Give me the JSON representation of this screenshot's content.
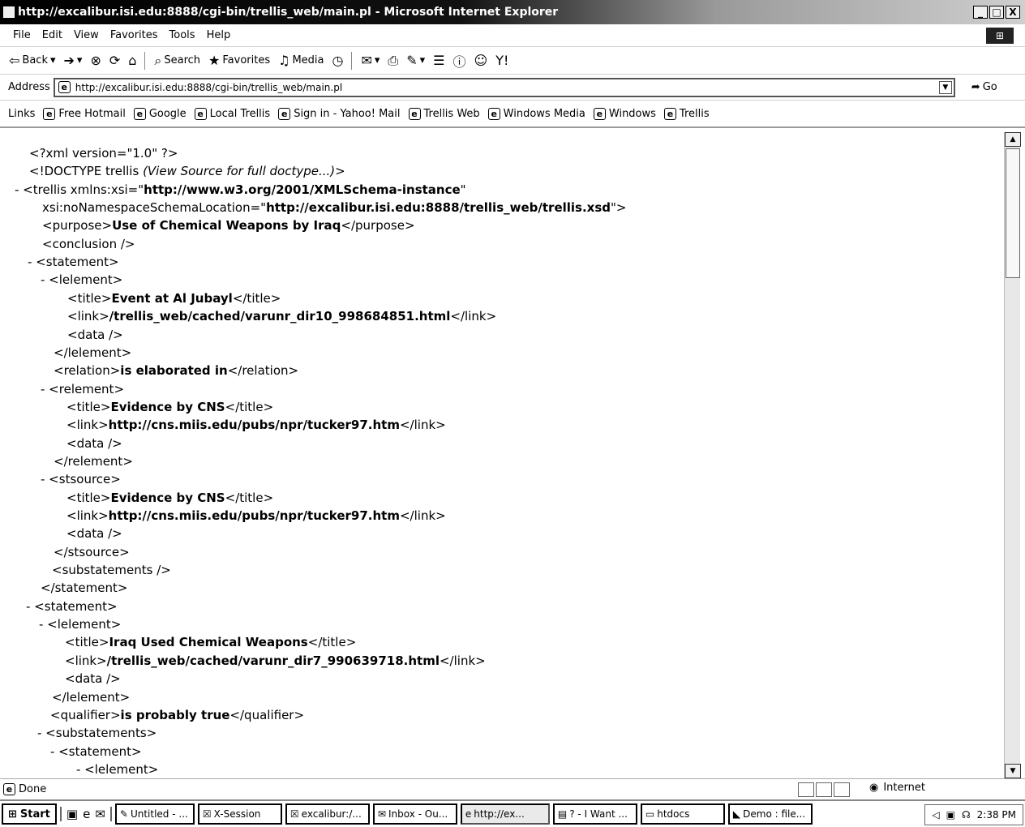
{
  "window": {
    "title": "http://excalibur.isi.edu:8888/cgi-bin/trellis_web/main.pl - Microsoft Internet Explorer",
    "minimize": "_",
    "maximize": "□",
    "close": "X"
  },
  "menu": [
    "File",
    "Edit",
    "View",
    "Favorites",
    "Tools",
    "Help"
  ],
  "toolbar": {
    "back": "Back",
    "search": "Search",
    "favorites": "Favorites",
    "media": "Media"
  },
  "address": {
    "label": "Address",
    "url": "http://excalibur.isi.edu:8888/cgi-bin/trellis_web/main.pl",
    "go": "Go"
  },
  "links": {
    "label": "Links",
    "items": [
      "Free Hotmail",
      "Google",
      "Local Trellis",
      "Sign in - Yahoo! Mail",
      "Trellis Web",
      "Windows Media",
      "Windows",
      "Trellis"
    ]
  },
  "xml": [
    {
      "indent": 36,
      "parts": [
        [
          "n",
          "<?xml version=\"1.0\" ?>"
        ]
      ]
    },
    {
      "indent": 36,
      "parts": [
        [
          "n",
          "<!DOCTYPE trellis "
        ],
        [
          "i",
          "(View Source for full doctype...)"
        ],
        [
          "n",
          ">"
        ]
      ]
    },
    {
      "indent": 18,
      "parts": [
        [
          "n",
          "- <trellis xmlns:xsi=\""
        ],
        [
          "b",
          "http://www.w3.org/2001/XMLSchema-instance"
        ],
        [
          "n",
          "\""
        ]
      ]
    },
    {
      "indent": 52,
      "parts": [
        [
          "n",
          "xsi:noNamespaceSchemaLocation=\""
        ],
        [
          "b",
          "http://excalibur.isi.edu:8888/trellis_web/trellis.xsd"
        ],
        [
          "n",
          "\">"
        ]
      ]
    },
    {
      "indent": 52,
      "parts": [
        [
          "n",
          "<purpose>"
        ],
        [
          "b",
          "Use of Chemical Weapons by Iraq"
        ],
        [
          "n",
          "</purpose>"
        ]
      ]
    },
    {
      "indent": 52,
      "parts": [
        [
          "n",
          "<conclusion />"
        ]
      ]
    },
    {
      "indent": 34,
      "parts": [
        [
          "n",
          "- <statement>"
        ]
      ]
    },
    {
      "indent": 50,
      "parts": [
        [
          "n",
          "- <lelement>"
        ]
      ]
    },
    {
      "indent": 83,
      "parts": [
        [
          "n",
          "<title>"
        ],
        [
          "b",
          "Event at Al Jubayl"
        ],
        [
          "n",
          "</title>"
        ]
      ]
    },
    {
      "indent": 83,
      "parts": [
        [
          "n",
          "<link>"
        ],
        [
          "b",
          "/trellis_web/cached/varunr_dir10_998684851.html"
        ],
        [
          "n",
          "</link>"
        ]
      ]
    },
    {
      "indent": 83,
      "parts": [
        [
          "n",
          "<data />"
        ]
      ]
    },
    {
      "indent": 66,
      "parts": [
        [
          "n",
          "</lelement>"
        ]
      ]
    },
    {
      "indent": 66,
      "parts": [
        [
          "n",
          "<relation>"
        ],
        [
          "b",
          "is elaborated in"
        ],
        [
          "n",
          "</relation>"
        ]
      ]
    },
    {
      "indent": 50,
      "parts": [
        [
          "n",
          "- <relement>"
        ]
      ]
    },
    {
      "indent": 82,
      "parts": [
        [
          "n",
          "<title>"
        ],
        [
          "b",
          "Evidence by CNS"
        ],
        [
          "n",
          "</title>"
        ]
      ]
    },
    {
      "indent": 82,
      "parts": [
        [
          "n",
          "<link>"
        ],
        [
          "b",
          "http://cns.miis.edu/pubs/npr/tucker97.htm"
        ],
        [
          "n",
          "</link>"
        ]
      ]
    },
    {
      "indent": 82,
      "parts": [
        [
          "n",
          "<data />"
        ]
      ]
    },
    {
      "indent": 66,
      "parts": [
        [
          "n",
          "</relement>"
        ]
      ]
    },
    {
      "indent": 50,
      "parts": [
        [
          "n",
          "- <stsource>"
        ]
      ]
    },
    {
      "indent": 82,
      "parts": [
        [
          "n",
          "<title>"
        ],
        [
          "b",
          "Evidence by CNS"
        ],
        [
          "n",
          "</title>"
        ]
      ]
    },
    {
      "indent": 82,
      "parts": [
        [
          "n",
          "<link>"
        ],
        [
          "b",
          "http://cns.miis.edu/pubs/npr/tucker97.htm"
        ],
        [
          "n",
          "</link>"
        ]
      ]
    },
    {
      "indent": 82,
      "parts": [
        [
          "n",
          "<data />"
        ]
      ]
    },
    {
      "indent": 66,
      "parts": [
        [
          "n",
          "</stsource>"
        ]
      ]
    },
    {
      "indent": 64,
      "parts": [
        [
          "n",
          "<substatements />"
        ]
      ]
    },
    {
      "indent": 50,
      "parts": [
        [
          "n",
          "</statement>"
        ]
      ]
    },
    {
      "indent": 32,
      "parts": [
        [
          "n",
          "- <statement>"
        ]
      ]
    },
    {
      "indent": 48,
      "parts": [
        [
          "n",
          "- <lelement>"
        ]
      ]
    },
    {
      "indent": 80,
      "parts": [
        [
          "n",
          "<title>"
        ],
        [
          "b",
          "Iraq Used Chemical Weapons"
        ],
        [
          "n",
          "</title>"
        ]
      ]
    },
    {
      "indent": 80,
      "parts": [
        [
          "n",
          "<link>"
        ],
        [
          "b",
          "/trellis_web/cached/varunr_dir7_990639718.html"
        ],
        [
          "n",
          "</link>"
        ]
      ]
    },
    {
      "indent": 80,
      "parts": [
        [
          "n",
          "<data />"
        ]
      ]
    },
    {
      "indent": 64,
      "parts": [
        [
          "n",
          "</lelement>"
        ]
      ]
    },
    {
      "indent": 62,
      "parts": [
        [
          "n",
          "<qualifier>"
        ],
        [
          "b",
          "is probably true"
        ],
        [
          "n",
          "</qualifier>"
        ]
      ]
    },
    {
      "indent": 46,
      "parts": [
        [
          "n",
          "- <substatements>"
        ]
      ]
    },
    {
      "indent": 62,
      "parts": [
        [
          "n",
          "- <statement>"
        ]
      ]
    },
    {
      "indent": 94,
      "parts": [
        [
          "n",
          "- <lelement>"
        ]
      ]
    }
  ],
  "status": {
    "text": "Done",
    "zone": "Internet"
  },
  "taskbar": {
    "start": "Start",
    "tasks": [
      "Untitled - ...",
      "X-Session",
      "excalibur:/...",
      "Inbox - Ou...",
      "http://ex...",
      "? - I Want ...",
      "htdocs",
      "Demo : file..."
    ],
    "active_index": 4,
    "clock": "2:38 PM"
  }
}
